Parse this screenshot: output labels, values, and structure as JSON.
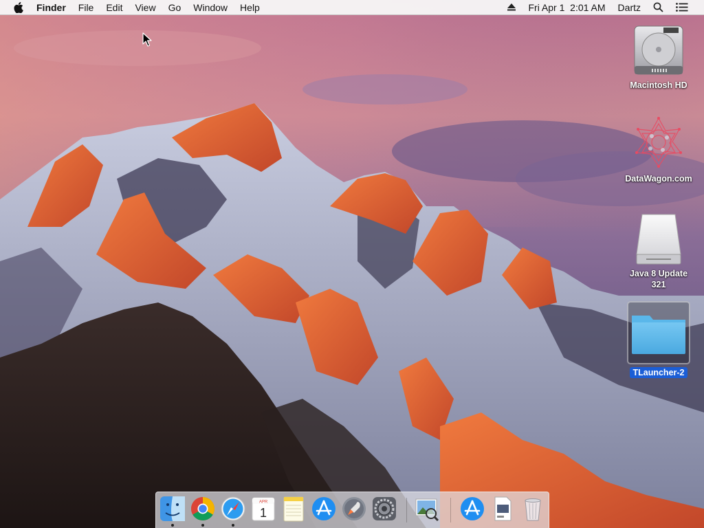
{
  "menubar": {
    "app_name": "Finder",
    "menus": [
      "File",
      "Edit",
      "View",
      "Go",
      "Window",
      "Help"
    ],
    "clock": "Fri Apr 1  2:01 AM",
    "user": "Dartz",
    "icons": [
      "apple-icon",
      "eject-icon",
      "spotlight-search-icon",
      "notification-center-icon"
    ]
  },
  "desktop": {
    "icons": [
      {
        "label": "Macintosh HD",
        "icon": "hard-drive-icon"
      },
      {
        "label": "DataWagon.com",
        "icon": "network-share-icon"
      },
      {
        "label": "Java 8 Update 321",
        "icon": "external-drive-icon"
      },
      {
        "label": "TLauncher-2",
        "icon": "folder-icon",
        "selected": true
      }
    ]
  },
  "dock": {
    "apps": [
      {
        "name": "Finder",
        "icon": "finder-icon",
        "running": true
      },
      {
        "name": "Google Chrome",
        "icon": "chrome-icon",
        "running": true
      },
      {
        "name": "Safari",
        "icon": "safari-icon",
        "running": true
      },
      {
        "name": "Calendar",
        "icon": "calendar-icon",
        "month": "APR",
        "day": "1"
      },
      {
        "name": "Notes",
        "icon": "notes-icon"
      },
      {
        "name": "App Store",
        "icon": "app-store-icon"
      },
      {
        "name": "Launchpad",
        "icon": "launchpad-icon"
      },
      {
        "name": "System Preferences",
        "icon": "system-preferences-icon"
      },
      {
        "name": "Preview",
        "icon": "preview-icon"
      },
      {
        "name": "App Store Downloads",
        "icon": "app-store-folder-icon"
      },
      {
        "name": "Document",
        "icon": "png-document-icon"
      },
      {
        "name": "Trash",
        "icon": "trash-icon"
      }
    ]
  }
}
